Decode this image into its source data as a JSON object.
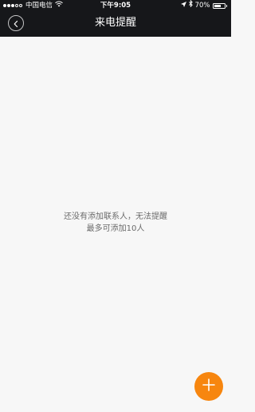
{
  "status_bar": {
    "signal_bars_filled": 3,
    "signal_bars_total": 5,
    "carrier": "中国电信",
    "wifi_icon": "wifi-icon",
    "time": "下午9:05",
    "location_icon": "location-arrow-icon",
    "bluetooth_icon": "bluetooth-icon",
    "battery_percent": "70%",
    "battery_level": 0.7
  },
  "header": {
    "back_icon": "chevron-left-icon",
    "title": "来电提醒"
  },
  "empty_state": {
    "line1": "还没有添加联系人，无法提醒",
    "line2": "最多可添加10人"
  },
  "fab": {
    "icon": "plus-icon",
    "color": "#f7860f"
  },
  "colors": {
    "header_bg": "#16171a",
    "page_bg": "#f7f7f7",
    "message_text": "#6b6b6b"
  }
}
